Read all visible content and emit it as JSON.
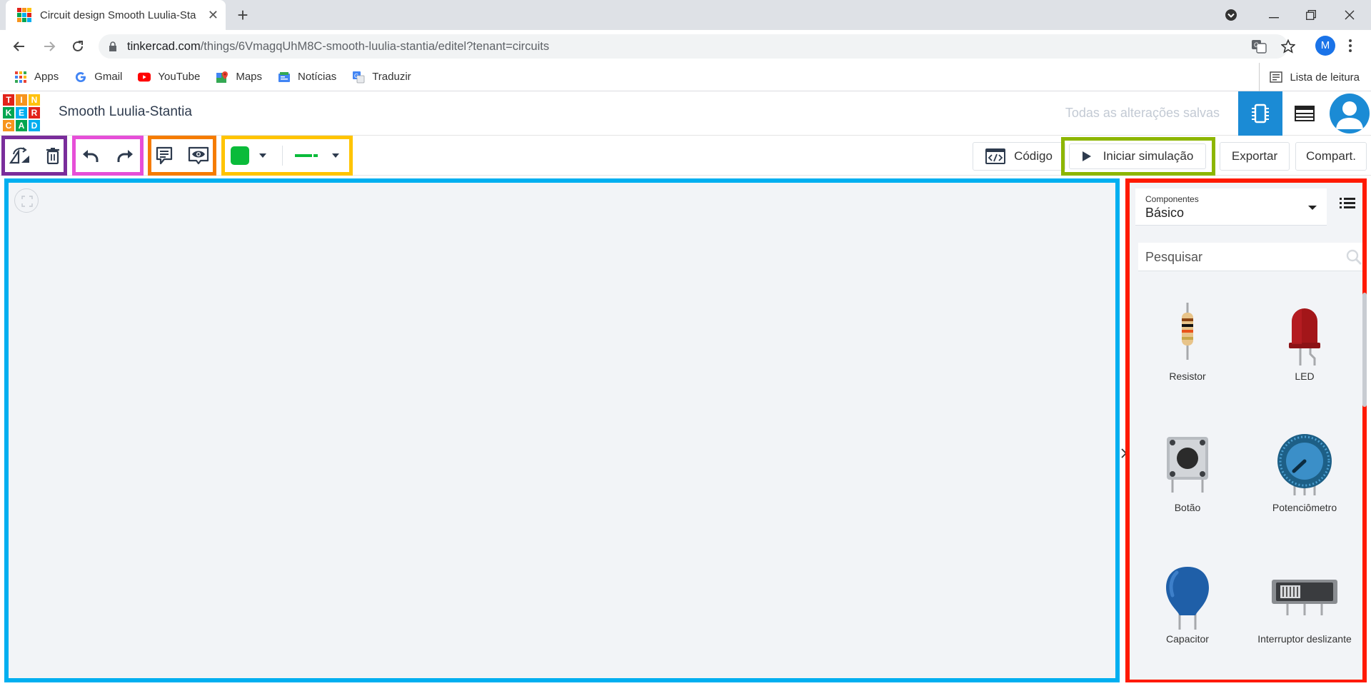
{
  "browser": {
    "tab_title": "Circuit design Smooth Luulia-Sta",
    "tab_close": "✕",
    "new_tab": "+",
    "url_host": "tinkercad.com",
    "url_path": "/things/6VmagqUhM8C-smooth-luulia-stantia/editel?tenant=circuits",
    "profile_initial": "M",
    "bookmarks": [
      {
        "label": "Apps",
        "icon": "apps-grid-icon"
      },
      {
        "label": "Gmail",
        "icon": "google-icon"
      },
      {
        "label": "YouTube",
        "icon": "youtube-icon"
      },
      {
        "label": "Maps",
        "icon": "maps-icon"
      },
      {
        "label": "Notícias",
        "icon": "news-icon"
      },
      {
        "label": "Traduzir",
        "icon": "translate-icon"
      }
    ],
    "reading_list": "Lista de leitura"
  },
  "app": {
    "logo_letters": [
      "T",
      "I",
      "N",
      "K",
      "E",
      "R",
      "C",
      "A",
      "D"
    ],
    "logo_colors": [
      "#e2231a",
      "#f7941d",
      "#ffc20e",
      "#00a651",
      "#00aeef",
      "#e2231a",
      "#f7941d",
      "#00a651",
      "#00aeef"
    ],
    "design_title": "Smooth Luulia-Stantia",
    "save_status": "Todas as alterações salvas"
  },
  "toolbar": {
    "code_label": "Código",
    "simulate_label": "Iniciar simulação",
    "export_label": "Exportar",
    "share_label": "Compart.",
    "wire_color": "#0abb3a",
    "highlight_colors": {
      "rotate_delete": "#7a2d9b",
      "undo_redo": "#e64fd8",
      "notes_view": "#f57c00",
      "color_wire": "#ffc400",
      "simulate": "#8db600",
      "canvas": "#00aff0",
      "panel": "#ff1a00"
    }
  },
  "panel": {
    "dropdown_small_label": "Componentes",
    "dropdown_value": "Básico",
    "search_placeholder": "Pesquisar",
    "components": [
      {
        "label": "Resistor",
        "icon": "resistor-icon"
      },
      {
        "label": "LED",
        "icon": "led-icon"
      },
      {
        "label": "Botão",
        "icon": "pushbutton-icon"
      },
      {
        "label": "Potenciômetro",
        "icon": "potentiometer-icon"
      },
      {
        "label": "Capacitor",
        "icon": "capacitor-icon"
      },
      {
        "label": "Interruptor deslizante",
        "icon": "slide-switch-icon"
      }
    ]
  }
}
